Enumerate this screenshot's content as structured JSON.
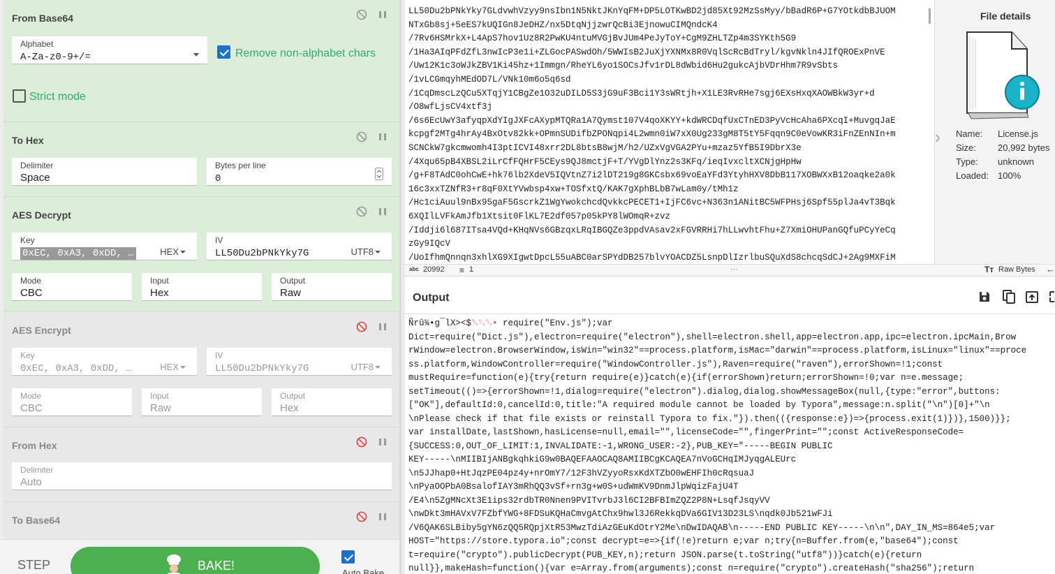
{
  "recipe": {
    "from_base64": {
      "title": "From Base64",
      "alphabet_label": "Alphabet",
      "alphabet_value": "A-Za-z0-9+/=",
      "remove_nonalpha_label": "Remove non-alphabet chars",
      "remove_nonalpha_checked": true,
      "strict_mode_label": "Strict mode",
      "strict_mode_checked": false
    },
    "to_hex": {
      "title": "To Hex",
      "delimiter_label": "Delimiter",
      "delimiter_value": "Space",
      "bytes_label": "Bytes per line",
      "bytes_value": "0"
    },
    "aes_decrypt": {
      "title": "AES Decrypt",
      "key_label": "Key",
      "key_value": "0xEC, 0xA3, 0xDD, …",
      "key_format": "HEX",
      "iv_label": "IV",
      "iv_value": "LL50Du2bPNkYky7G",
      "iv_format": "UTF8",
      "mode_label": "Mode",
      "mode_value": "CBC",
      "input_label": "Input",
      "input_value": "Hex",
      "output_label": "Output",
      "output_value": "Raw"
    },
    "aes_encrypt": {
      "title": "AES Encrypt",
      "key_label": "Key",
      "key_value": "0xEC, 0xA3, 0xDD, …",
      "key_format": "HEX",
      "iv_label": "IV",
      "iv_value": "LL50Du2bPNkYky7G",
      "iv_format": "UTF8",
      "mode_label": "Mode",
      "mode_value": "CBC",
      "input_label": "Input",
      "input_value": "Raw",
      "output_label": "Output",
      "output_value": "Hex"
    },
    "from_hex": {
      "title": "From Hex",
      "delimiter_label": "Delimiter",
      "delimiter_value": "Auto"
    },
    "to_base64": {
      "title": "To Base64"
    }
  },
  "controls": {
    "step_label": "STEP",
    "bake_label": "BAKE!",
    "autobake_label": "Auto Bake",
    "autobake_checked": true
  },
  "input": {
    "lines": [
      "LL50Du2bPNkYky7GLdvwhVzyy9nsIbn1N5NktJKnYqFM+DP5LOTKwBD2jd85Xt92MzSsMyy/bBadR6P+G7YOtkdbBJUOM",
      "NTxGb8sj+5eES7kUQIGn8JeDHZ/nx5DtqNjjzwrQcBi3EjnowuCIMQndcK4",
      "/7Rv6HSMrkX+L4ApS7hov1Uz8R2PwKU4ntuMVGjBvJUm4PeJyToY+CgM9ZHLTZp4m3SYKth5G9",
      "/1Ha3AIqPFdZfL3nwIcP3e1i+ZLGocPASwdOh/5WWIsB2JuXjYXNMx8R0VqlScRcBdTryl/kgvNkln4JIfQROExPnVE",
      "/Uw12K1c3oWJkZBV1Ki45hz+1Immgn/RheYL6yo1SOCsJfv1rDL8dWbid6Hu2gukcAjbVDrHhm7R9vSbts",
      "/1vLCGmqyhMEdOD7L/VNk10m6o5q6sd",
      "/1CqDmscLzQCu5XTqjY1CBgZe1O32uDILD5S3jG9uF3Bci1Y3sWRtjh+X1LE3RvRHe7sgj6EXsHxqXAOWBkW3yr+d",
      "/O8wfLjsCV4xtf3j",
      "/6s6EcUwY3afyqpXdYIgJXFcAXypMTQRa1A7Qymst107V4qoXKYY+kdWRCDqfUxCTnED3PyVcHcAha6PXcqI+MuvgqJaE",
      "kcpgf2MTg4hrAy4BxOtv82kk+OPmnSUDifbZPONqpi4L2wmn0iW7xX0Ug233gM8T5tY5Fqqn9C0eVowKR3iFnZEnNIn+m",
      "SCNCkW7gkcmwomh4I3ptICVI48xrr2DL8btsB8wjM/h2/UZxVgVGA2PYu+mzaz5YfB5I9DbrX3e",
      "/4Xqu65pB4XBSL2iLrCfFQHrF5CEys9QJ8mctjF+T/YVgDlYnz2s3KFq/ieqIvxcltXCNjgHpHw",
      "/g+F8TAdC0ohCwE+hk76lb2XdeV5IQVtnZ7i2lDT219g8GKCsbx69voEaYFd3YtyhHXV8DbB117XOBWXxB12oaqke2a0k",
      "16c3xxTZNfR3+r8qF0XtYVwbsp4xw+TOSfxtQ/KAK7gXphBLbB7wLam0y/tMh1z",
      "/Hc1ciAuul9nBx95gaF5GscrkZ1WgYwokchcdQvkkcPECET1+IjFC6vc+N363n1ANitBC5WFPHsj6Spf55plJa4vT3Bqk",
      "6XQIlLVFkAmJfb1Xtsit0FlKL7E2df057p05kPY8lWOmqR+zvz",
      "/Iddji6l687ITsa4VQd+KHqNVs6GBzqxLRqIBGQZe3ppdVAsav2xFGVRRHi7hLLwvhtFhu+Z7XmiOHUPanGQfuPCyYeCq",
      "zGy9IQcV",
      "/UoIfhmQnnqn3xhlXG9XIgwtDpcL55uABC0arSPYdDB257blvYOACDZ5LsnpDlIzrlbuSQuXdS8chcqSdCJ+2Ag9MXFiM"
    ],
    "char_count": "20992",
    "line_count": "1",
    "raw_bytes_label": "Raw Bytes"
  },
  "details": {
    "title": "File details",
    "name_label": "Name:",
    "name_value": "License.js",
    "size_label": "Size:",
    "size_value": "20,992 bytes",
    "type_label": "Type:",
    "type_value": "unknown",
    "loaded_label": "Loaded:",
    "loaded_value": "100%"
  },
  "output": {
    "title": "Output",
    "garbled_prefix": "Ñrû¾•g¯lX><$",
    "garbled_ctl": "␒␓␔•",
    "first_line_rest": " require(\"Env.js\");var",
    "lines": [
      "Dict=require(\"Dict.js\"),electron=require(\"electron\"),shell=electron.shell,app=electron.app,ipc=electron.ipcMain,Brow",
      "rWindow=electron.BrowserWindow,isWin=\"win32\"==process.platform,isMac=\"darwin\"==process.platform,isLinux=\"linux\"==proce",
      "ss.platform,WindowController=require(\"WindowController.js\"),Raven=require(\"raven\"),errorShown=!1;const",
      "mustRequire=function(e){try{return require(e)}catch(e){if(errorShown)return;errorShown=!0;var n=e.message;",
      "setTimeout(()=>{errorShown=!1,dialog=require(\"electron\").dialog,dialog.showMessageBox(null,{type:\"error\",buttons:",
      "[\"OK\"],defaultId:0,cancelId:0,title:\"A required module cannot be loaded by Typora\",message:n.split(\"\\n\")[0]+\"\\n",
      "\\nPlease check if that file exists or reinstall Typora to fix.\"}).then(({response:e})=>{process.exit(1)})},1500)}};",
      "var installDate,lastShown,hasLicense=null,email=\"\",licenseCode=\"\",fingerPrint=\"\";const ActiveResponseCode=",
      "{SUCCESS:0,OUT_OF_LIMIT:1,INVALIDATE:-1,WRONG_USER:-2},PUB_KEY=\"-----BEGIN PUBLIC",
      "KEY-----\\nMIIBIjANBgkqhkiG9w0BAQEFAAOCAQ8AMIIBCgKCAQEA7nVoGCHqIMJyqgALEUrc",
      "\\n5JJhap0+HtJqzPE04pz4y+nrOmY7/12F3hVZyyoRsxKdXTZbO0wEHFIh0cRqsuaJ",
      "\\nPyaOOPbA0BsalofIAY3mRhQQ3vSf+rn3g+w0S+udWmKV9DnmJlpWqizFajU4T",
      "/E4\\n5ZgMNcXt3E1ips32rdbTR0Nnen9PVITvrbJ3l6CI2BFBImZQZ2P8N+LsqfJsqyVV",
      "\\nwDkt3mHAVxV7FZbfYWG+8FDSuKQHaCmvgAtChx9hwl3J6RekkqDVa6GIV13D23LS\\nqdk0Jb521wFJi",
      "/V6QAK6SLBiby5gYN6zQQ5RQpjXtR53MwzTdiAzGEuKdOtrY2Me\\nDwIDAQAB\\n-----END PUBLIC KEY-----\\n\\n\",DAY_IN_MS=864e5;var",
      "HOST=\"https://store.typora.io\";const decrypt=e=>{if(!e)return e;var n;try{n=Buffer.from(e,\"base64\");const",
      "t=require(\"crypto\").publicDecrypt(PUB_KEY,n);return JSON.parse(t.toString(\"utf8\"))}catch(e){return",
      "null}},makeHash=function(){var e=Array.from(arguments);const n=require(\"crypto\").createHash(\"sha256\");return"
    ]
  },
  "colors": {
    "enabled_op_bg": "#dcedd9",
    "disabled_op_bg": "#e8e8e8",
    "bake_button": "#4caf50",
    "checkbox_accent": "#1a73c8",
    "disabled_icon_red": "#d9534f"
  }
}
